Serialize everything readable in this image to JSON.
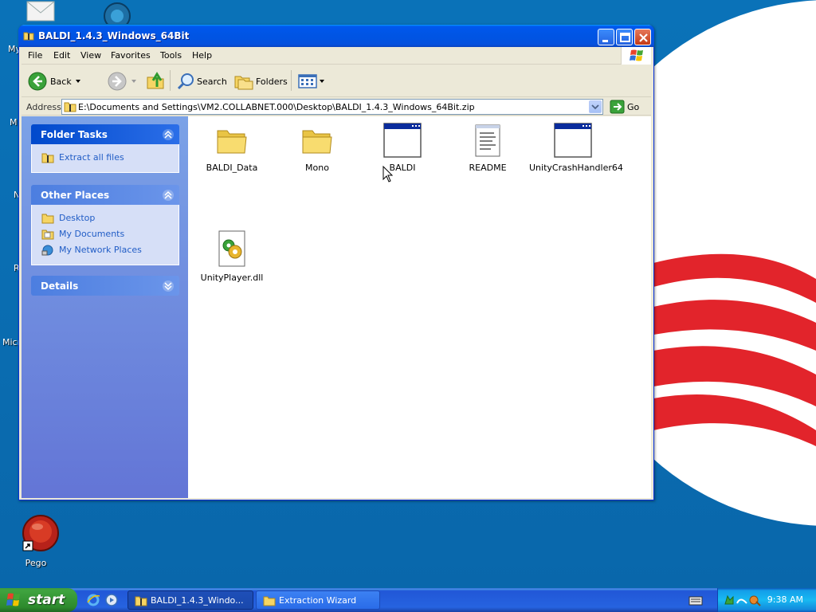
{
  "desktop": {
    "icons": [
      {
        "name": "My",
        "label": "My"
      },
      {
        "name": "Pego",
        "label": "Pego"
      }
    ],
    "cut_labels": [
      "My",
      "M",
      "N",
      "R",
      "Micr"
    ]
  },
  "window": {
    "title": "BALDI_1.4.3_Windows_64Bit",
    "menu": [
      "File",
      "Edit",
      "View",
      "Favorites",
      "Tools",
      "Help"
    ],
    "toolbar": {
      "back_label": "Back",
      "search_label": "Search",
      "folders_label": "Folders"
    },
    "address": {
      "label": "Address",
      "value": "E:\\Documents and Settings\\VM2.COLLABNET.000\\Desktop\\BALDI_1.4.3_Windows_64Bit.zip",
      "go_label": "Go"
    }
  },
  "taskpane": {
    "folder_tasks": {
      "title": "Folder Tasks",
      "items": [
        "Extract all files"
      ]
    },
    "other_places": {
      "title": "Other Places",
      "items": [
        "Desktop",
        "My Documents",
        "My Network Places"
      ]
    },
    "details": {
      "title": "Details"
    }
  },
  "files": [
    {
      "label": "BALDI_Data",
      "icon": "folder-icon"
    },
    {
      "label": "Mono",
      "icon": "folder-icon"
    },
    {
      "label": "BALDI",
      "icon": "application-icon"
    },
    {
      "label": "README",
      "icon": "text-document-icon"
    },
    {
      "label": "UnityCrashHandler64",
      "icon": "application-icon"
    },
    {
      "label": "UnityPlayer.dll",
      "icon": "dll-icon"
    }
  ],
  "taskbar": {
    "start_label": "start",
    "buttons": [
      {
        "label": "BALDI_1.4.3_Windo...",
        "active": true
      },
      {
        "label": "Extraction Wizard",
        "active": false
      }
    ],
    "clock": "9:38 AM"
  },
  "colors": {
    "titlebar": "#0054e3",
    "taskpane": "#6375d6",
    "link": "#215dc6",
    "start_green": "#3fa43f"
  }
}
